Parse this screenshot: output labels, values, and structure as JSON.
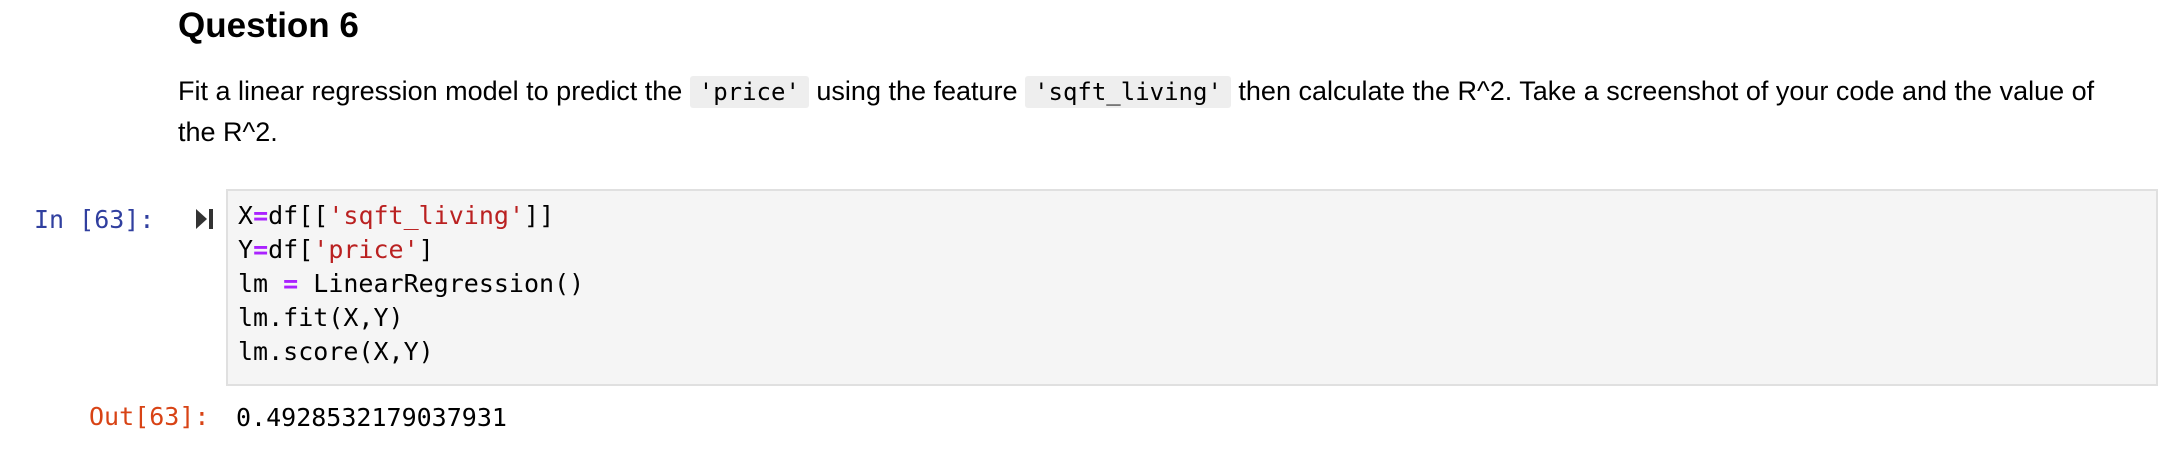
{
  "markdown": {
    "heading": "Question 6",
    "p_part1": "Fit a linear regression model to predict the ",
    "code1": "'price'",
    "p_part2": " using the feature ",
    "code2": "'sqft_living'",
    "p_part3": " then calculate the R^2. Take a screenshot of your code and the value of the R^2."
  },
  "cell": {
    "in_prompt": "In [63]:",
    "run_icon": "step-forward-icon",
    "lines": [
      {
        "a": "X",
        "op": "=",
        "b": "df[[",
        "s": "'sqft_living'",
        "c": "]]"
      },
      {
        "a": "Y",
        "op": "=",
        "b": "df[",
        "s": "'price'",
        "c": "]"
      },
      {
        "a": "lm ",
        "op": "=",
        "b": " LinearRegression()",
        "s": "",
        "c": ""
      },
      {
        "a": "lm.fit(X,Y)",
        "op": "",
        "b": "",
        "s": "",
        "c": ""
      },
      {
        "a": "lm.score(X,Y)",
        "op": "",
        "b": "",
        "s": "",
        "c": ""
      }
    ],
    "out_prompt": "Out[63]:",
    "output": "0.4928532179037931"
  },
  "colors": {
    "in_prompt": "#303f9f",
    "out_prompt": "#d84315",
    "operator": "#aa22ff",
    "string": "#ba2121"
  }
}
